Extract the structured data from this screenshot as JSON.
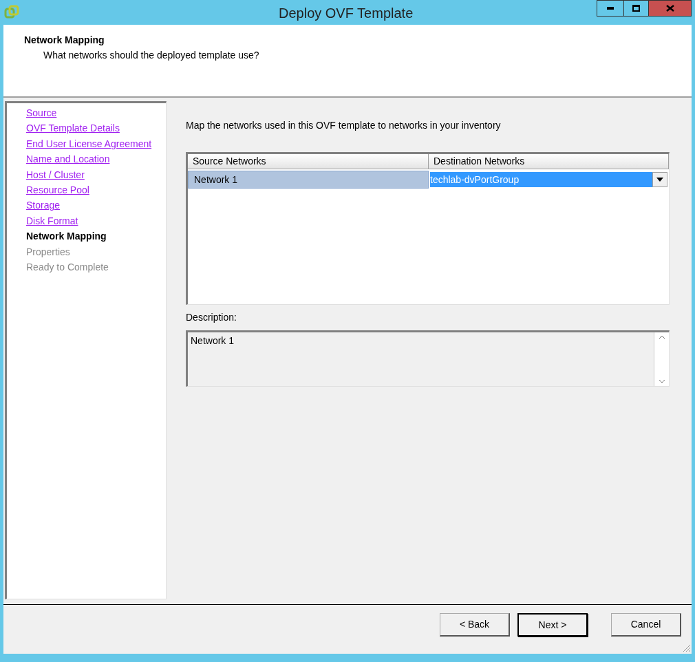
{
  "window": {
    "title": "Deploy OVF Template"
  },
  "header": {
    "title": "Network Mapping",
    "subtitle": "What networks should the deployed template use?"
  },
  "steps": [
    {
      "label": "Source",
      "kind": "link"
    },
    {
      "label": "OVF Template Details",
      "kind": "link"
    },
    {
      "label": "End User License Agreement",
      "kind": "link"
    },
    {
      "label": "Name and Location",
      "kind": "link"
    },
    {
      "label": "Host / Cluster",
      "kind": "link"
    },
    {
      "label": "Resource Pool",
      "kind": "link"
    },
    {
      "label": "Storage",
      "kind": "link"
    },
    {
      "label": "Disk Format",
      "kind": "link"
    },
    {
      "label": "Network Mapping",
      "kind": "current"
    },
    {
      "label": "Properties",
      "kind": "pending"
    },
    {
      "label": "Ready to Complete",
      "kind": "pending"
    }
  ],
  "instruction": "Map the networks used in this OVF template to networks in your inventory",
  "table": {
    "columns": [
      "Source Networks",
      "Destination Networks"
    ],
    "rows": [
      {
        "source": "Network 1",
        "destination": "techlab-dvPortGroup",
        "selected": true
      }
    ]
  },
  "description": {
    "label": "Description:",
    "value": "Network 1"
  },
  "buttons": [
    "< Back",
    "Next >",
    "Cancel"
  ]
}
